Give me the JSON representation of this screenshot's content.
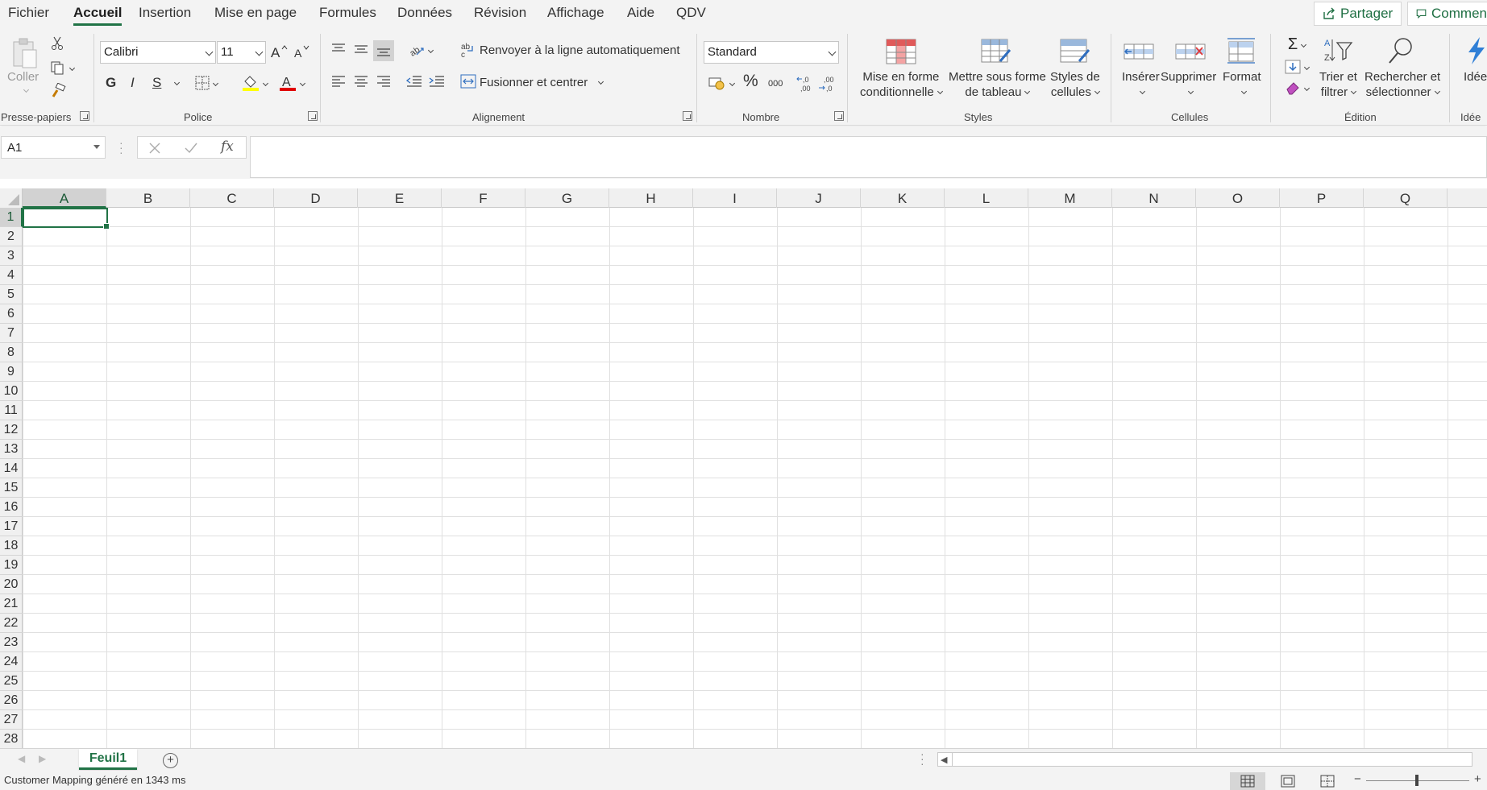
{
  "menu": {
    "tabs": [
      "Fichier",
      "Accueil",
      "Insertion",
      "Mise en page",
      "Formules",
      "Données",
      "Révision",
      "Affichage",
      "Aide",
      "QDV"
    ],
    "active_tab": "Accueil",
    "share_label": "Partager",
    "comments_label": "Commen"
  },
  "ribbon": {
    "clipboard": {
      "paste_label": "Coller",
      "group_label": "Presse-papiers"
    },
    "font": {
      "font_name": "Calibri",
      "font_size": "11",
      "bold": "G",
      "italic": "I",
      "underline": "S",
      "font_color_glyph": "A",
      "group_label": "Police"
    },
    "alignment": {
      "wrap_label": "Renvoyer à la ligne automatiquement",
      "merge_label": "Fusionner et centrer",
      "group_label": "Alignement"
    },
    "number": {
      "format": "Standard",
      "percent": "%",
      "thousands": "000",
      "group_label": "Nombre"
    },
    "styles": {
      "conditional_line1": "Mise en forme",
      "conditional_line2": "conditionnelle",
      "table_line1": "Mettre sous forme",
      "table_line2": "de tableau",
      "cellstyles_line1": "Styles de",
      "cellstyles_line2": "cellules",
      "group_label": "Styles"
    },
    "cells": {
      "insert_label": "Insérer",
      "delete_label": "Supprimer",
      "format_label": "Format",
      "group_label": "Cellules"
    },
    "editing": {
      "sort_line1": "Trier et",
      "sort_line2": "filtrer",
      "find_line1": "Rechercher et",
      "find_line2": "sélectionner",
      "group_label": "Édition"
    },
    "ideas": {
      "label": "Idée",
      "group_label": "Idée"
    }
  },
  "formula_bar": {
    "name_box": "A1",
    "fx": "fx",
    "formula": ""
  },
  "grid": {
    "columns": [
      "A",
      "B",
      "C",
      "D",
      "E",
      "F",
      "G",
      "H",
      "I",
      "J",
      "K",
      "L",
      "M",
      "N",
      "O",
      "P",
      "Q"
    ],
    "rows": [
      "1",
      "2",
      "3",
      "4",
      "5",
      "6",
      "7",
      "8",
      "9",
      "10",
      "11",
      "12",
      "13",
      "14",
      "15",
      "16",
      "17",
      "18",
      "19",
      "20",
      "21",
      "22",
      "23",
      "24",
      "25",
      "26",
      "27",
      "28"
    ],
    "selected_cell": "A1"
  },
  "sheets": {
    "tabs": [
      "Feuil1"
    ],
    "active": "Feuil1",
    "add_glyph": "+"
  },
  "status": {
    "message": "Customer Mapping généré en 1343 ms",
    "zoom_minus": "−",
    "zoom_plus": "+"
  },
  "colors": {
    "accent": "#217346",
    "ribbon_bg": "#f3f3f3",
    "gridline": "#e0e0e0"
  }
}
